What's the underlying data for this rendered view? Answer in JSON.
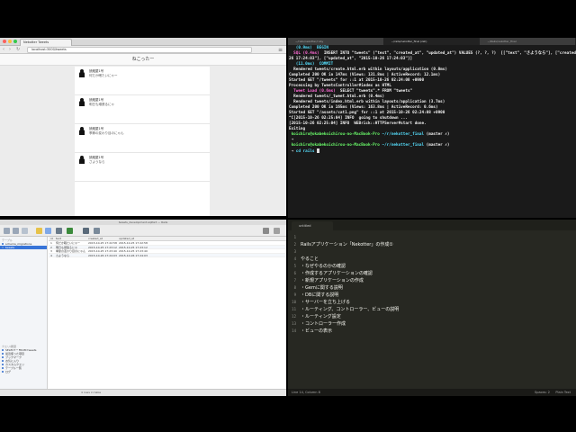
{
  "browser": {
    "tab_title": "Nekotter Tweets",
    "url": "localhost:3000/tweets",
    "nav_back": "‹",
    "nav_forward": "›",
    "nav_reload": "↻",
    "menu_icon": "≡",
    "page_header": "ねこったー",
    "tweets": [
      {
        "name": "読蔵屋1号",
        "text": "何だか眠たいにゃー"
      },
      {
        "name": "読蔵屋1号",
        "text": "明日も頑張るにゃ"
      },
      {
        "name": "読蔵屋1号",
        "text": "季節の変わり目のにゃん"
      },
      {
        "name": "読蔵屋1号",
        "text": "さようなら"
      }
    ]
  },
  "terminal": {
    "tabs": [
      "~/rails/nekotter/ruby",
      "~/rails/nekotter_final (zsh)",
      "~/Rails/nekotter_final"
    ],
    "lines": [
      [
        {
          "t": "   "
        },
        {
          "t": "(0.9ms)  BEGIN",
          "c": "c-cyan"
        }
      ],
      [
        {
          "t": "  SQL (0.4ms)",
          "c": "c-mag"
        },
        {
          "t": "  INSERT INTO \"tweets\" (\"text\", \"created_at\", \"updated_at\") VALUES (?, ?, ?)  [[\"text\", \"さようなら\"], [\"created_at\", \"2015-10-"
        }
      ],
      [
        {
          "t": "26 17:24:03\"], [\"updated_at\", \"2015-10-26 17:24:03\"]]"
        }
      ],
      [
        {
          "t": "   "
        },
        {
          "t": "(11.0ms)  COMMIT",
          "c": "c-cyan"
        }
      ],
      [
        {
          "t": "  Rendered tweets/create.html.erb within layouts/application (0.0ms)"
        }
      ],
      [
        {
          "t": "Completed 200 OK in 147ms (Views: 131.8ms | ActiveRecord: 12.1ms)"
        }
      ],
      [
        {
          "t": ""
        }
      ],
      [
        {
          "t": ""
        }
      ],
      [
        {
          "t": "Started GET \"/tweets\" for ::1 at 2015-10-26 02:24:08 +0900"
        }
      ],
      [
        {
          "t": "Processing by TweetsController#index as HTML"
        }
      ],
      [
        {
          "t": "  Tweet Load (0.6ms)",
          "c": "c-mag"
        },
        {
          "t": "  SELECT \"tweets\".* FROM \"tweets\""
        }
      ],
      [
        {
          "t": "  Rendered tweets/_tweet.html.erb (0.4ms)"
        }
      ],
      [
        {
          "t": "  Rendered tweets/index.html.erb within layouts/application (3.7ms)"
        }
      ],
      [
        {
          "t": "Completed 200 OK in 165ms (Views: 163.8ms | ActiveRecord: 0.6ms)"
        }
      ],
      [
        {
          "t": ""
        }
      ],
      [
        {
          "t": ""
        }
      ],
      [
        {
          "t": "Started GET \"/assets/cat1.png\" for ::1 at 2015-10-26 02:24:08 +0900"
        }
      ],
      [
        {
          "t": "^C[2015-10-26 02:25:04] INFO  going to shutdown ..."
        }
      ],
      [
        {
          "t": "[2015-10-26 02:25:04] INFO  WEBrick::HTTPServer#start done."
        }
      ],
      [
        {
          "t": "Exiting"
        }
      ],
      [
        {
          "t": " koichiro@okabekoichirou-no-MacBook-Pro ",
          "c": "c-green"
        },
        {
          "t": "~/r/nekotter_final",
          "c": "c-cyan"
        },
        {
          "t": " (master ✗)"
        }
      ],
      [
        {
          "t": " ➜ "
        }
      ],
      [
        {
          "t": " koichiro@okabekoichirou-no-MacBook-Pro ",
          "c": "c-green"
        },
        {
          "t": "~/r/nekotter_final",
          "c": "c-cyan"
        },
        {
          "t": " (master ✗)"
        }
      ],
      [
        {
          "t": " ➜ "
        },
        {
          "t": "cd rails",
          "c": "c-cyan"
        }
      ]
    ]
  },
  "dbapp": {
    "window_title": "tweets_development.sqlite3 — Rails",
    "sidebar_header": "テーブル",
    "tables": [
      "schema_migrations",
      "tweets"
    ],
    "sidebar_header2": "クエリ/履歴",
    "queries": [
      "SELECT * FROM tweets",
      "最近使った項目",
      "ブックマーク",
      "お気に入り",
      "カスタムクエリ",
      "テーブル一覧",
      "ログ"
    ],
    "columns": [
      "id",
      "text",
      "created_at",
      "updated_at"
    ],
    "rows": [
      [
        "1",
        "何だか眠たいにゃー",
        "2015-10-25 17:22:58",
        "2015-10-25 17:22:58"
      ],
      [
        "2",
        "明日も頑張るにゃ",
        "2015-10-25 17:23:12",
        "2015-10-25 17:23:12"
      ],
      [
        "3",
        "季節の変わり目のにゃん",
        "2015-10-25 17:23:40",
        "2015-10-25 17:23:40"
      ],
      [
        "4",
        "さようなら",
        "2015-10-26 17:24:03",
        "2015-10-26 17:24:03"
      ]
    ],
    "status_text": "4 rows in table"
  },
  "editor": {
    "tab_label": "untitled",
    "lines": [
      "",
      "Railsアプリケーション「Nekotter」の作成①",
      "",
      "やること",
      "・なぜやるのかの確認",
      "・作成するアプリケーションの確認",
      "・新規アプリケーションの作成",
      "・Gemに関する説明",
      "・DBに関する説明",
      "・サーバーを立ち上げる",
      "・ルーティング、コントローラー、ビューの説明",
      "・ルーティング設定",
      "・コントローラー作成",
      "・ビューの表示"
    ],
    "status_left": "Line 14, Column 8",
    "status_spaces": "Spaces: 2",
    "status_syntax": "Plain Text"
  }
}
